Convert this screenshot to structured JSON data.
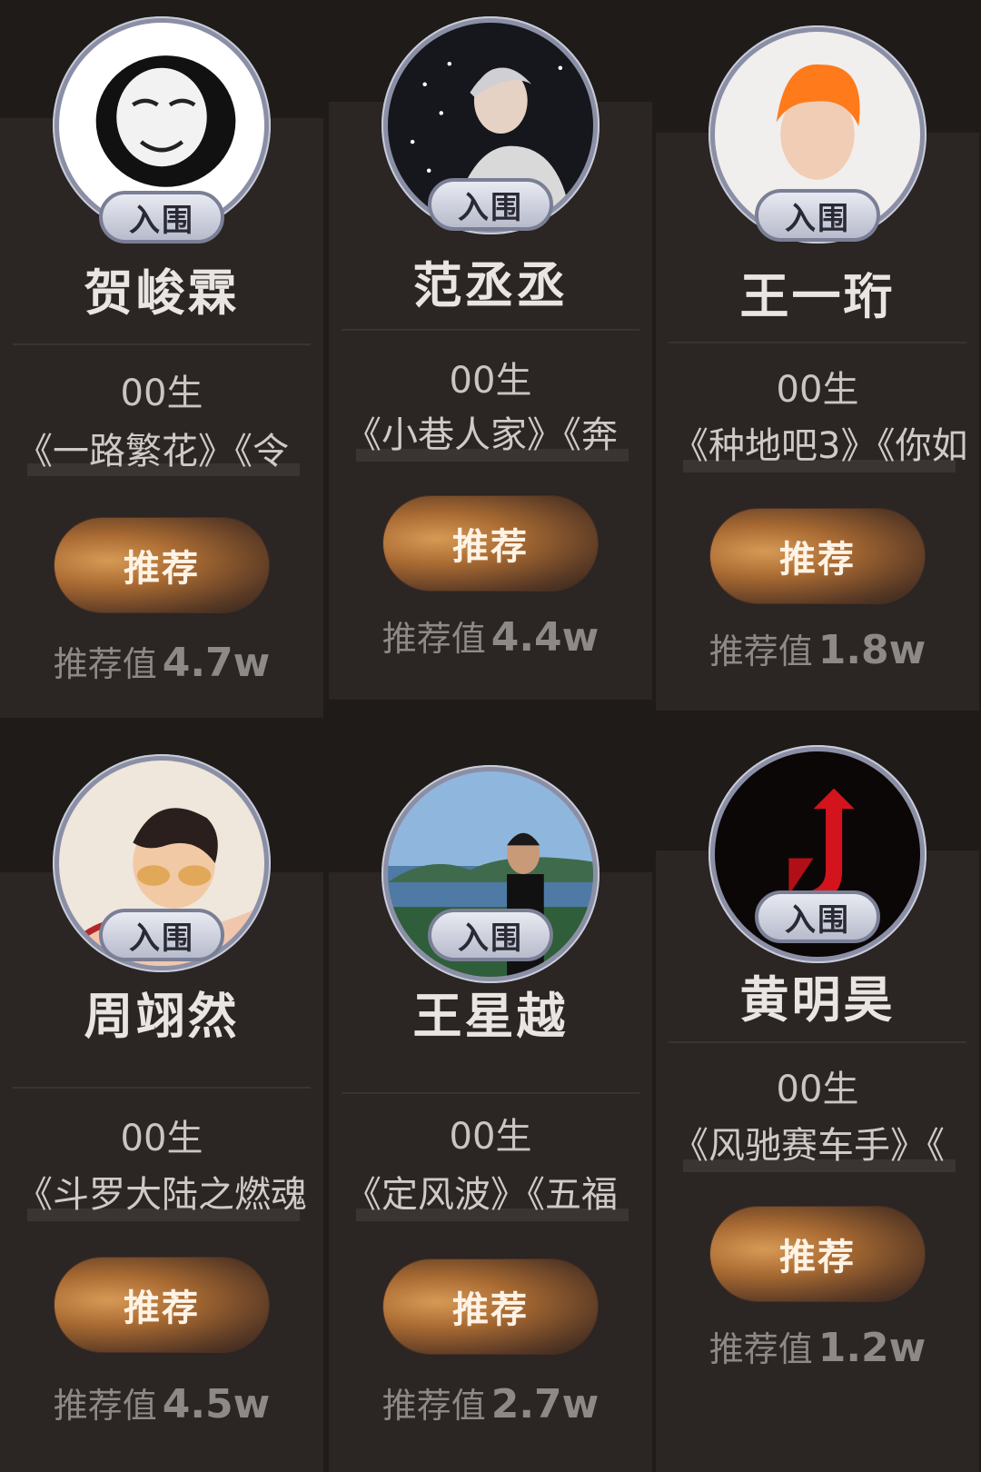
{
  "badge_label": "入围",
  "button_label": "推荐",
  "score_label": "推荐值",
  "cards": [
    {
      "name": "贺峻霖",
      "age": "00生",
      "works": "《一路繁花》《令",
      "score": "4.7w"
    },
    {
      "name": "范丞丞",
      "age": "00生",
      "works": "《小巷人家》《奔",
      "score": "4.4w"
    },
    {
      "name": "王一珩",
      "age": "00生",
      "works": "《种地吧3》《你如",
      "score": "1.8w"
    },
    {
      "name": "周翊然",
      "age": "00生",
      "works": "《斗罗大陆之燃魂",
      "score": "4.5w"
    },
    {
      "name": "王星越",
      "age": "00生",
      "works": "《定风波》《五福",
      "score": "2.7w"
    },
    {
      "name": "黄明昊",
      "age": "00生",
      "works": "《风驰赛车手》《",
      "score": "1.2w"
    }
  ]
}
